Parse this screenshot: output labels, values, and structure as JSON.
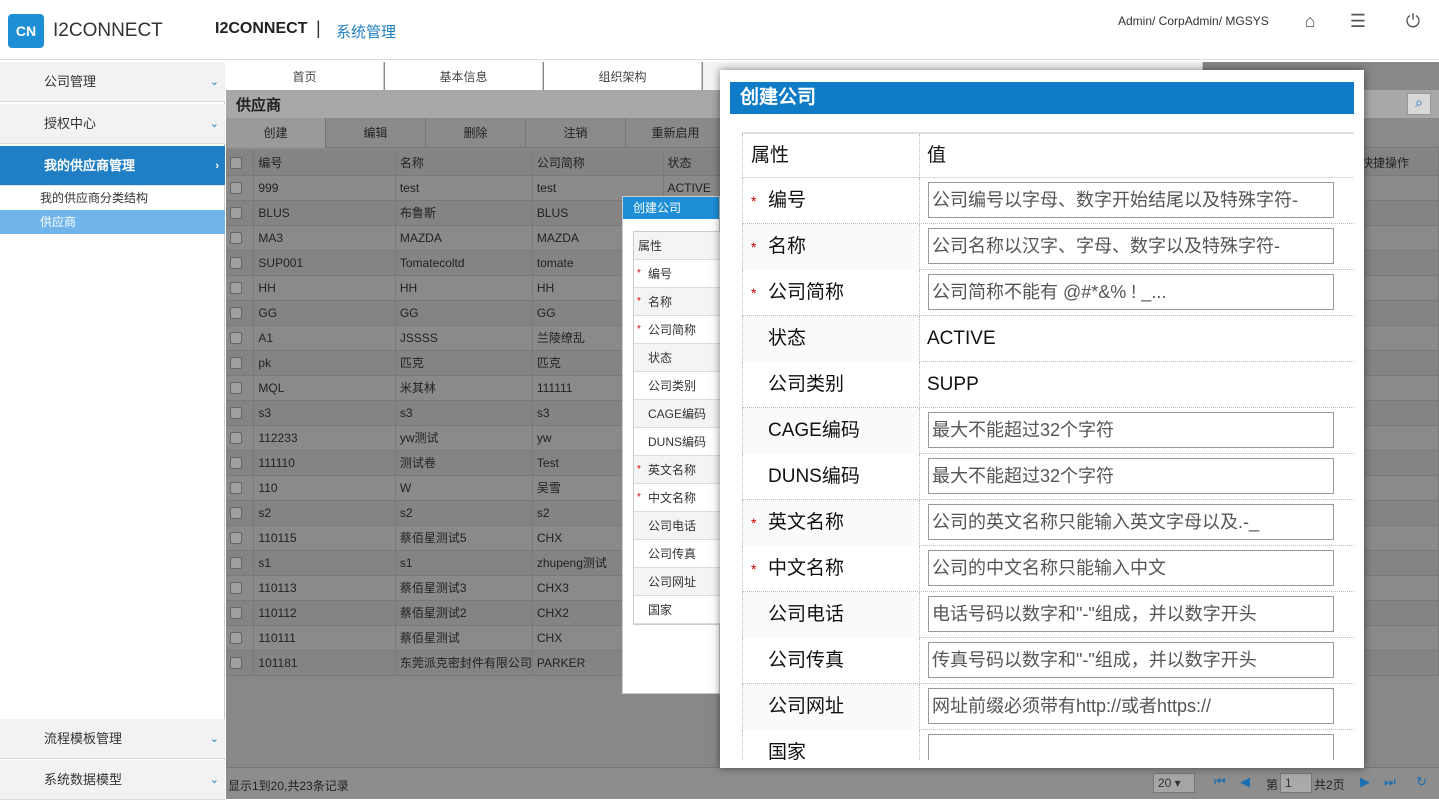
{
  "header": {
    "logo_text": "CN",
    "brand": "I2CONNECT",
    "app_title": "I2CONNECT",
    "separator": "|",
    "app_subtitle": "系统管理",
    "user_info": "Admin/ CorpAdmin/ MGSYS"
  },
  "sidebar": {
    "items": [
      {
        "label": "公司管理"
      },
      {
        "label": "授权中心"
      },
      {
        "label": "我的供应商管理"
      }
    ],
    "subitems": [
      {
        "label": "我的供应商分类结构"
      },
      {
        "label": "供应商"
      }
    ],
    "bottom_items": [
      {
        "label": "流程模板管理"
      },
      {
        "label": "系统数据模型"
      }
    ]
  },
  "tabs": [
    {
      "label": "首页"
    },
    {
      "label": "基本信息"
    },
    {
      "label": "组织架构"
    }
  ],
  "grid": {
    "title": "供应商",
    "toolbar": [
      "创建",
      "编辑",
      "删除",
      "注销",
      "重新启用"
    ],
    "columns": [
      "编号",
      "名称",
      "公司简称",
      "状态"
    ],
    "last_column": "快捷操作",
    "rows": [
      [
        "999",
        "test",
        "test",
        "ACTIVE"
      ],
      [
        "BLUS",
        "布鲁斯",
        "BLUS",
        ""
      ],
      [
        "MA3",
        "MAZDA",
        "MAZDA",
        ""
      ],
      [
        "SUP001",
        "Tomatecoltd",
        "tomate",
        ""
      ],
      [
        "HH",
        "HH",
        "HH",
        ""
      ],
      [
        "GG",
        "GG",
        "GG",
        ""
      ],
      [
        "A1",
        "JSSSS",
        "兰陵缭乱",
        ""
      ],
      [
        "pk",
        "匹克",
        "匹克",
        ""
      ],
      [
        "MQL",
        "米其林",
        "111111",
        ""
      ],
      [
        "s3",
        "s3",
        "s3",
        ""
      ],
      [
        "112233",
        "yw测试",
        "yw",
        ""
      ],
      [
        "111110",
        "测试卷",
        "Test",
        ""
      ],
      [
        "110",
        "W",
        "吴雪",
        ""
      ],
      [
        "s2",
        "s2",
        "s2",
        ""
      ],
      [
        "110115",
        "蔡佰星测试5",
        "CHX",
        ""
      ],
      [
        "s1",
        "s1",
        "zhupeng测试",
        ""
      ],
      [
        "110113",
        "蔡佰星测试3",
        "CHX3",
        ""
      ],
      [
        "110112",
        "蔡佰星测试2",
        "CHX2",
        ""
      ],
      [
        "110111",
        "蔡佰星测试",
        "CHX",
        ""
      ],
      [
        "101181",
        "东莞派克密封件有限公司",
        "PARKER",
        ""
      ]
    ]
  },
  "footer": {
    "info": "显示1到20,共23条记录",
    "page_size": "20 ▾",
    "page_prefix": "第",
    "page_value": "1",
    "page_total": "共2页"
  },
  "small_dialog": {
    "title": "创建公司",
    "rows": [
      {
        "label": "属性",
        "required": false
      },
      {
        "label": "编号",
        "required": true
      },
      {
        "label": "名称",
        "required": true
      },
      {
        "label": "公司简称",
        "required": true
      },
      {
        "label": "状态",
        "required": false
      },
      {
        "label": "公司类别",
        "required": false
      },
      {
        "label": "CAGE编码",
        "required": false
      },
      {
        "label": "DUNS编码",
        "required": false
      },
      {
        "label": "英文名称",
        "required": true
      },
      {
        "label": "中文名称",
        "required": true
      },
      {
        "label": "公司电话",
        "required": false
      },
      {
        "label": "公司传真",
        "required": false
      },
      {
        "label": "公司网址",
        "required": false
      },
      {
        "label": "国家",
        "required": false
      }
    ]
  },
  "dialog": {
    "title": "创建公司",
    "col_attr": "属性",
    "col_value": "值",
    "fields": [
      {
        "label": "编号",
        "required": true,
        "type": "input",
        "placeholder": "公司编号以字母、数字开始结尾以及特殊字符-"
      },
      {
        "label": "名称",
        "required": true,
        "type": "input",
        "placeholder": "公司名称以汉字、字母、数字以及特殊字符-"
      },
      {
        "label": "公司简称",
        "required": true,
        "type": "input",
        "placeholder": "公司简称不能有 @#*&% ! _..."
      },
      {
        "label": "状态",
        "required": false,
        "type": "text",
        "value": "ACTIVE"
      },
      {
        "label": "公司类别",
        "required": false,
        "type": "text",
        "value": "SUPP"
      },
      {
        "label": "CAGE编码",
        "required": false,
        "type": "input",
        "placeholder": "最大不能超过32个字符"
      },
      {
        "label": "DUNS编码",
        "required": false,
        "type": "input",
        "placeholder": "最大不能超过32个字符"
      },
      {
        "label": "英文名称",
        "required": true,
        "type": "input",
        "placeholder": "公司的英文名称只能输入英文字母以及.-_"
      },
      {
        "label": "中文名称",
        "required": true,
        "type": "input",
        "placeholder": "公司的中文名称只能输入中文"
      },
      {
        "label": "公司电话",
        "required": false,
        "type": "input",
        "placeholder": "电话号码以数字和\"-\"组成，并以数字开头"
      },
      {
        "label": "公司传真",
        "required": false,
        "type": "input",
        "placeholder": "传真号码以数字和\"-\"组成，并以数字开头"
      },
      {
        "label": "公司网址",
        "required": false,
        "type": "input",
        "placeholder": "网址前缀必须带有http://或者https://"
      },
      {
        "label": "国家",
        "required": false,
        "type": "input",
        "placeholder": ""
      }
    ]
  }
}
